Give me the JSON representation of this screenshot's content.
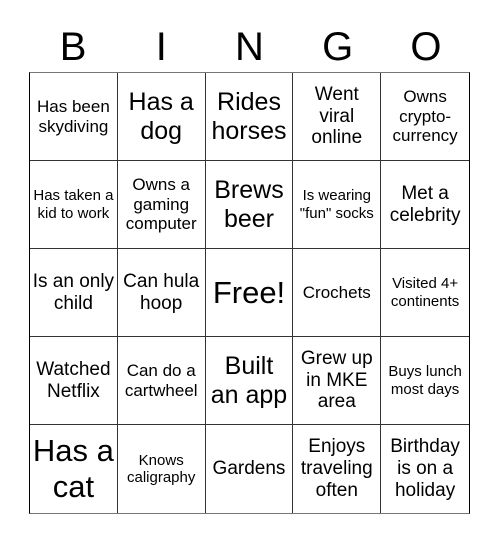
{
  "header": {
    "letters": [
      "B",
      "I",
      "N",
      "G",
      "O"
    ]
  },
  "cells": [
    "Has been skydiving",
    "Has a dog",
    "Rides horses",
    "Went viral online",
    "Owns crypto-currency",
    "Has taken a kid to work",
    "Owns a gaming computer",
    "Brews beer",
    "Is wearing \"fun\" socks",
    "Met a celebrity",
    "Is an only child",
    "Can hula hoop",
    "Free!",
    "Crochets",
    "Visited 4+ continents",
    "Watched Netflix",
    "Can do a cartwheel",
    "Built an app",
    "Grew up in MKE area",
    "Buys lunch most days",
    "Has a cat",
    "Knows caligraphy",
    "Gardens",
    "Enjoys traveling often",
    "Birthday is on a holiday"
  ]
}
